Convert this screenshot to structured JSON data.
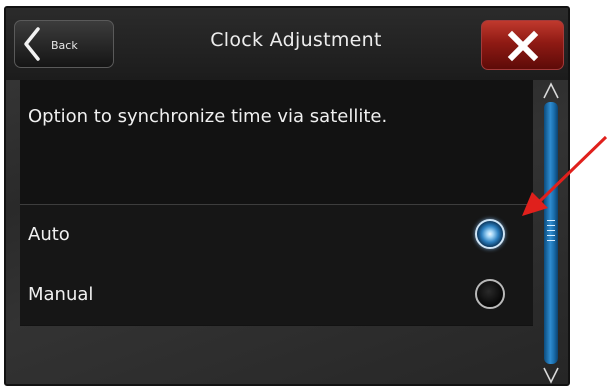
{
  "header": {
    "back_label": "Back",
    "title": "Clock Adjustment"
  },
  "description": "Option to synchronize time via satellite.",
  "options": [
    {
      "label": "Auto",
      "selected": true
    },
    {
      "label": "Manual",
      "selected": false
    }
  ],
  "colors": {
    "accent": "#2f8cd0",
    "close_red": "#a21e17",
    "annotation_arrow": "#e0201c"
  },
  "icons": {
    "back": "chevron-left-icon",
    "close": "close-x-icon",
    "scroll_up": "chevron-up-icon",
    "scroll_down": "chevron-down-icon"
  }
}
